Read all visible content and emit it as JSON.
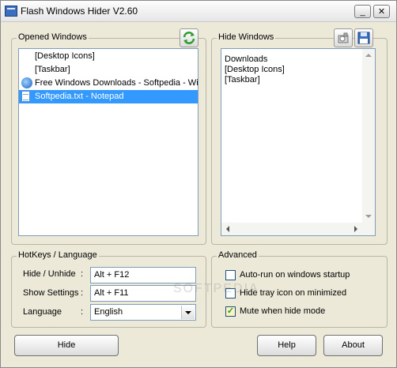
{
  "window": {
    "title": "Flash Windows Hider V2.60"
  },
  "titlebar": {
    "minimize_glyph": "_",
    "close_glyph": "✕"
  },
  "opened": {
    "label": "Opened Windows",
    "items": [
      {
        "text": "[Desktop Icons]",
        "icon": "none"
      },
      {
        "text": "[Taskbar]",
        "icon": "none"
      },
      {
        "text": "Free Windows Downloads - Softpedia - Wir",
        "icon": "ie-icon"
      },
      {
        "text": "Softpedia.txt - Notepad",
        "icon": "notepad-icon",
        "selected": true
      }
    ]
  },
  "hide": {
    "label": "Hide Windows",
    "items": [
      "Downloads",
      "[Desktop Icons]",
      "[Taskbar]"
    ]
  },
  "hotkeys": {
    "label": "HotKeys / Language",
    "hide_label": "Hide / Unhide",
    "hide_value": "Alt + F12",
    "settings_label": "Show Settings",
    "settings_value": "Alt + F11",
    "language_label": "Language",
    "language_value": "English",
    "colon": ":"
  },
  "advanced": {
    "label": "Advanced",
    "autorun": {
      "label": "Auto-run on windows startup",
      "checked": false
    },
    "hidetray": {
      "label": "Hide tray icon on minimized",
      "checked": false
    },
    "mute": {
      "label": "Mute when hide mode",
      "checked": true,
      "mark": "✓"
    }
  },
  "buttons": {
    "hide": "Hide",
    "help": "Help",
    "about": "About"
  },
  "watermark": "SOFTPEDIA",
  "colors": {
    "selection": "#3399ff",
    "refresh_green": "#2e9e2e",
    "save_blue": "#3a6fbf"
  }
}
